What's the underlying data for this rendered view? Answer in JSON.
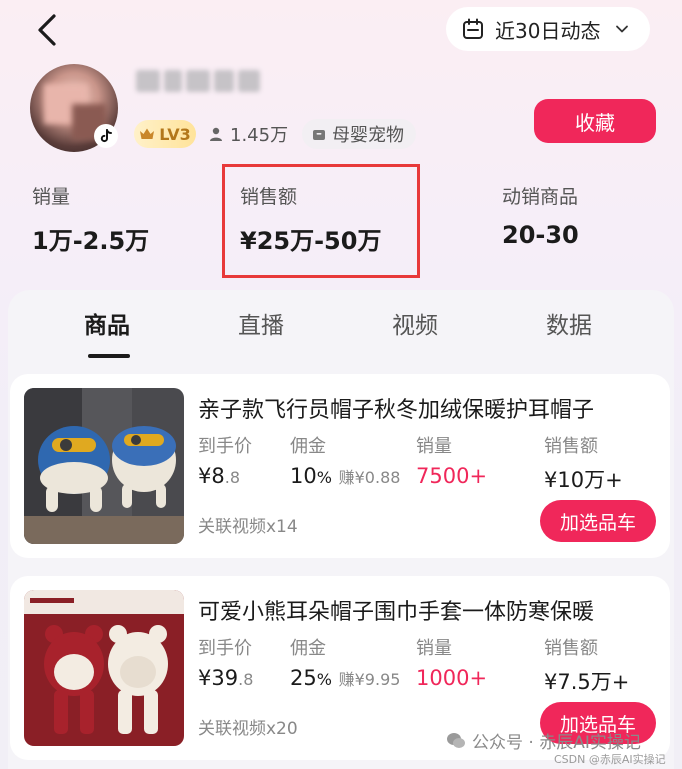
{
  "header": {
    "date_filter": "近30日动态"
  },
  "profile": {
    "level": "LV3",
    "fans": "1.45万",
    "category": "母婴宠物",
    "follow_label": "收藏"
  },
  "stats": [
    {
      "label": "销量",
      "value": "1万-2.5万"
    },
    {
      "label": "销售额",
      "value": "¥25万-50万"
    },
    {
      "label": "动销商品",
      "value": "20-30"
    }
  ],
  "tabs": [
    {
      "label": "商品",
      "active": true
    },
    {
      "label": "直播",
      "active": false
    },
    {
      "label": "视频",
      "active": false
    },
    {
      "label": "数据",
      "active": false
    }
  ],
  "products": [
    {
      "title": "亲子款飞行员帽子秋冬加绒保暖护耳帽子",
      "price_label": "到手价",
      "price_sym": "¥",
      "price_int": "8",
      "price_dec": ".8",
      "commission_label": "佣金",
      "commission_pct": "10",
      "commission_earn": "赚¥0.88",
      "sales_label": "销量",
      "sales": "7500+",
      "revenue_label": "销售额",
      "revenue": "¥10万+",
      "linked_videos": "关联视频x14",
      "cart_label": "加选品车"
    },
    {
      "title": "可爱小熊耳朵帽子围巾手套一体防寒保暖",
      "price_label": "到手价",
      "price_sym": "¥",
      "price_int": "39",
      "price_dec": ".8",
      "commission_label": "佣金",
      "commission_pct": "25",
      "commission_earn": "赚¥9.95",
      "sales_label": "销量",
      "sales": "1000+",
      "revenue_label": "销售额",
      "revenue": "¥7.5万+",
      "linked_videos": "关联视频x20",
      "cart_label": "加选品车"
    }
  ],
  "watermark": {
    "text": "公众号 · 赤辰AI实操记",
    "source": "CSDN @赤辰AI实操记"
  },
  "colors": {
    "accent": "#f0275a",
    "highlight_box": "#e8393a"
  }
}
